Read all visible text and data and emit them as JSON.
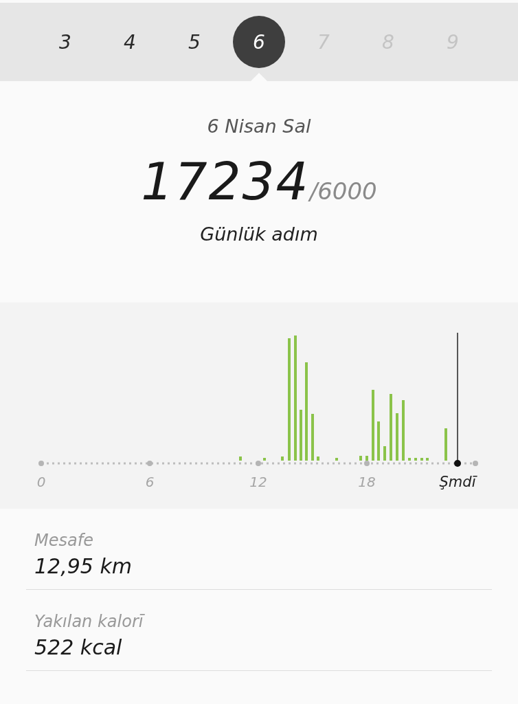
{
  "days": [
    {
      "label": "3",
      "selected": false,
      "disabled": false
    },
    {
      "label": "4",
      "selected": false,
      "disabled": false
    },
    {
      "label": "5",
      "selected": false,
      "disabled": false
    },
    {
      "label": "6",
      "selected": true,
      "disabled": false
    },
    {
      "label": "7",
      "selected": false,
      "disabled": true
    },
    {
      "label": "8",
      "selected": false,
      "disabled": true
    },
    {
      "label": "9",
      "selected": false,
      "disabled": true
    }
  ],
  "date": "6 Nisan Sal",
  "steps": {
    "value": "17234",
    "goal": "/6000",
    "label": "Günlük adım"
  },
  "chart": {
    "x_labels": [
      "0",
      "6",
      "12",
      "18"
    ],
    "now_label": "Şmdī"
  },
  "stats": [
    {
      "label": "Mesafe",
      "value": "12,95 km"
    },
    {
      "label": "Yakılan kalorī",
      "value": "522 kcal"
    }
  ]
}
